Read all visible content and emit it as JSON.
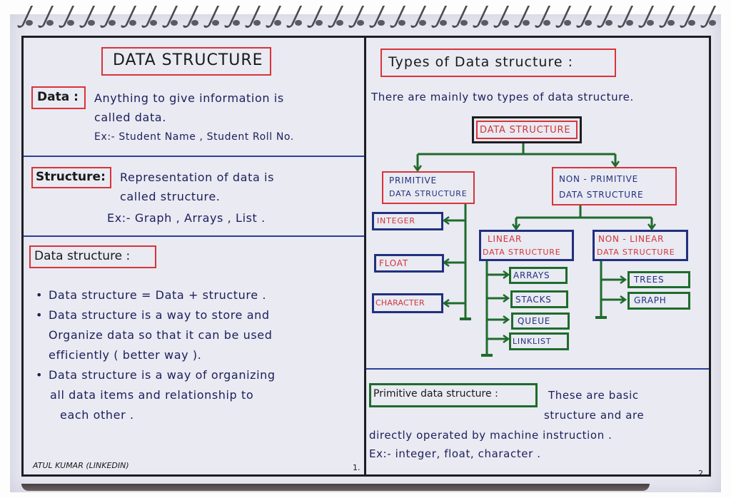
{
  "page1": {
    "title": "DATA STRUCTURE",
    "data_section": {
      "label": "Data :",
      "lines": [
        "Anything to give information is",
        "called data.",
        "Ex:- Student Name , Student Roll No."
      ]
    },
    "structure_section": {
      "label": "Structure:",
      "lines": [
        "Representation of data is",
        "called structure.",
        "Ex:- Graph , Arrays , List ."
      ]
    },
    "ds_section": {
      "label": "Data structure :",
      "bullets": [
        [
          "Data structure = Data + structure ."
        ],
        [
          "Data structure is a way to store and",
          "Organize data so that it can be used",
          "efficiently ( better way )."
        ],
        [
          "Data structure is a way of organizing",
          "all data items and relationship to",
          "each other ."
        ]
      ]
    },
    "author": "ATUL KUMAR (LINKEDIN)",
    "page_number": "1."
  },
  "page2": {
    "title": "Types of Data structure :",
    "intro": "There are mainly two types of data structure.",
    "tree": {
      "root": "DATA STRUCTURE",
      "primitive": {
        "line1": "PRIMITIVE",
        "line2": "DATA STRUCTURE",
        "children": [
          "INTEGER",
          "FLOAT",
          "CHARACTER"
        ]
      },
      "non_primitive": {
        "line1": "NON - PRIMITIVE",
        "line2": "DATA STRUCTURE",
        "linear": {
          "line1": "LINEAR",
          "line2": "DATA STRUCTURE",
          "children": [
            "ARRAYS",
            "STACKS",
            "QUEUE",
            "LINKLIST"
          ]
        },
        "non_linear": {
          "line1": "NON - LINEAR",
          "line2": "DATA STRUCTURE",
          "children": [
            "TREES",
            "GRAPH"
          ]
        }
      }
    },
    "primitive_def": {
      "label": "Primitive data structure :",
      "lines": [
        "These are basic",
        "structure and are",
        "directly operated by machine instruction .",
        "Ex:- integer, float, character ."
      ]
    },
    "page_number": "2."
  },
  "colors": {
    "ink_blue": "#1c1f5a",
    "marker_red": "#d8343a",
    "marker_blue": "#22307e",
    "marker_green": "#1f6b2c",
    "paper": "#e9eaf2"
  }
}
